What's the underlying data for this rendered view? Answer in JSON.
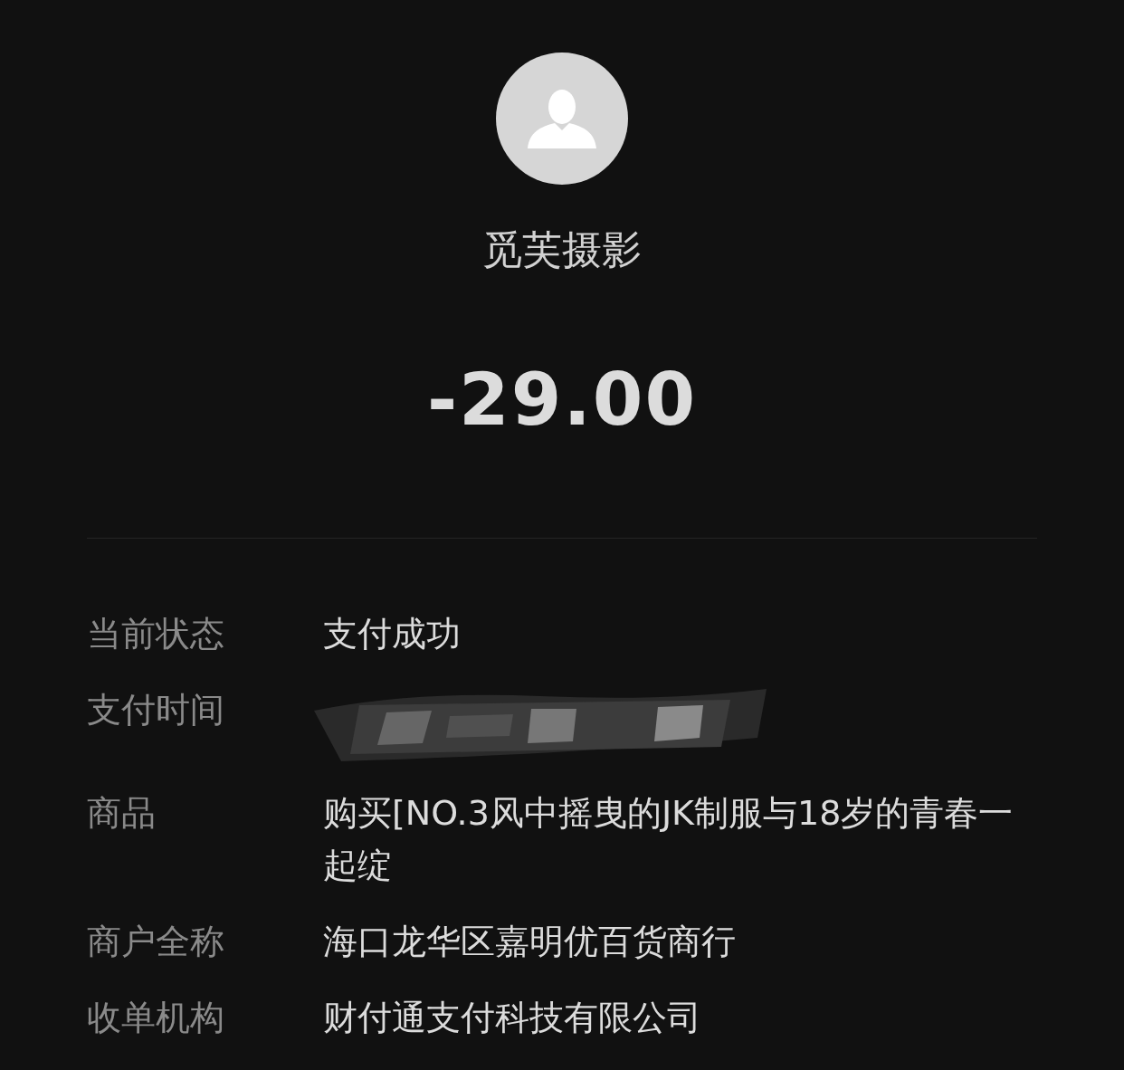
{
  "payee": {
    "avatar": {
      "kind": "silhouette"
    },
    "name": "觅芙摄影"
  },
  "amount": "-29.00",
  "details": [
    {
      "kind": "text",
      "label": "当前状态",
      "value": "支付成功"
    },
    {
      "kind": "redacted",
      "label": "支付时间"
    },
    {
      "kind": "text",
      "label": "商品",
      "value": "购买[NO.3风中摇曳的JK制服与18岁的青春一起绽"
    },
    {
      "kind": "text",
      "label": "商户全称",
      "value": "海口龙华区嘉明优百货商行"
    },
    {
      "kind": "text",
      "label": "收单机构",
      "value": "财付通支付科技有限公司"
    }
  ]
}
